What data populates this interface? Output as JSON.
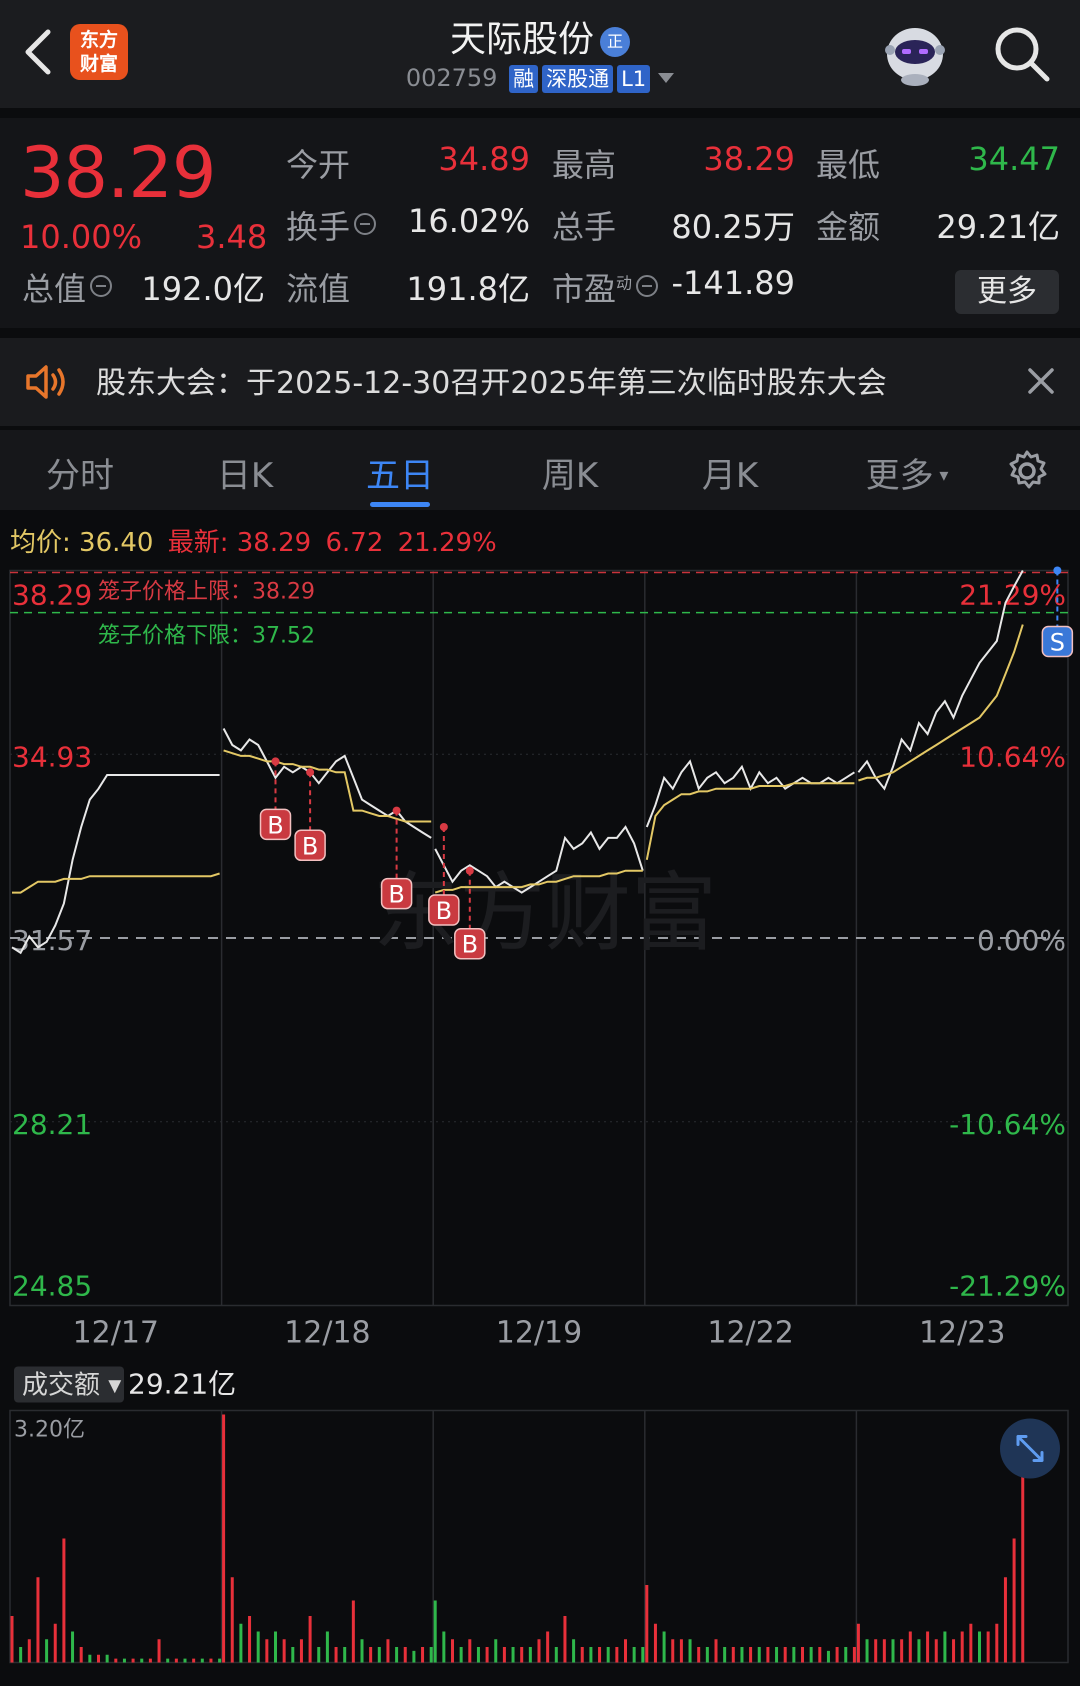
{
  "header": {
    "title": "天际股份",
    "title_badge": "正",
    "code": "002759",
    "tags": [
      "融",
      "深股通",
      "L1"
    ],
    "logo_text": [
      "东方",
      "财富"
    ]
  },
  "quote": {
    "price": "38.29",
    "change_pct": "10.00%",
    "change": "3.48",
    "rows": [
      [
        {
          "label": "今开",
          "value": "34.89",
          "color": "#e8303a"
        },
        {
          "label": "最高",
          "value": "38.29",
          "color": "#e8303a"
        },
        {
          "label": "最低",
          "value": "34.47",
          "color": "#2fb84b"
        }
      ],
      [
        {
          "label": "换手",
          "value": "16.02%",
          "color": "#e6e6e6"
        },
        {
          "label": "总手",
          "value": "80.25万",
          "color": "#e6e6e6"
        },
        {
          "label": "金额",
          "value": "29.21亿",
          "color": "#e6e6e6"
        }
      ],
      [
        {
          "label": "总值",
          "value": "192.0亿",
          "color": "#e6e6e6"
        },
        {
          "label": "流值",
          "value": "191.8亿",
          "color": "#e6e6e6"
        },
        {
          "label": "市盈",
          "value": "-141.89",
          "color": "#e6e6e6"
        }
      ]
    ],
    "pe_sup": "动",
    "more_label": "更多"
  },
  "notice": {
    "text": "股东大会：于2025-12-30召开2025年第三次临时股东大会"
  },
  "tabs": [
    "分时",
    "日K",
    "五日",
    "周K",
    "月K",
    "更多"
  ],
  "active_tab": "五日",
  "avg_bar": {
    "avg_label": "均价:",
    "avg_value": "36.40",
    "latest_label": "最新:",
    "latest_value": "38.29",
    "latest_change": "6.72",
    "latest_pct": "21.29%"
  },
  "chart_data": {
    "type": "line",
    "title": "",
    "x_labels": [
      "12/17",
      "12/18",
      "12/19",
      "12/22",
      "12/23"
    ],
    "y_ticks_left": [
      "38.29",
      "34.93",
      "31.57",
      "28.21",
      "24.85"
    ],
    "y_ticks_right": [
      "21.29%",
      "10.64%",
      "0.00%",
      "-10.64%",
      "-21.29%"
    ],
    "ylim": [
      24.85,
      38.29
    ],
    "base_price": 31.57,
    "cage_upper_label": "笼子价格上限：38.29",
    "cage_lower_label": "笼子价格下限：37.52",
    "cage_upper": 38.29,
    "cage_lower": 37.52,
    "watermark": "东方财富",
    "series": [
      {
        "values": [
          31.4,
          31.3,
          31.6,
          31.4,
          31.5,
          31.8,
          32.2,
          33.0,
          33.6,
          34.1,
          34.3,
          34.55,
          34.55,
          34.55,
          34.55,
          34.55,
          34.55,
          34.55,
          34.55,
          34.55,
          34.55,
          34.55,
          34.55,
          34.55,
          34.55,
          35.4,
          35.1,
          35.0,
          35.2,
          35.1,
          34.8,
          34.5,
          34.7,
          34.6,
          34.7,
          34.6,
          34.4,
          34.6,
          34.8,
          34.9,
          34.5,
          34.1,
          34.0,
          33.9,
          33.8,
          33.9,
          33.7,
          33.6,
          33.5,
          33.4,
          33.2,
          32.9,
          32.6,
          32.8,
          32.9,
          32.8,
          32.7,
          32.5,
          32.6,
          32.5,
          32.4,
          32.5,
          32.6,
          32.7,
          32.8,
          33.4,
          33.2,
          33.3,
          33.5,
          33.2,
          33.4,
          33.4,
          33.6,
          33.3,
          32.8,
          33.6,
          34.0,
          34.5,
          34.3,
          34.6,
          34.8,
          34.3,
          34.5,
          34.6,
          34.4,
          34.5,
          34.7,
          34.3,
          34.6,
          34.4,
          34.5,
          34.3,
          34.4,
          34.5,
          34.4,
          34.4,
          34.5,
          34.4,
          34.5,
          34.6,
          34.6,
          34.8,
          34.5,
          34.3,
          34.7,
          35.2,
          35.0,
          35.5,
          35.3,
          35.7,
          35.9,
          35.6,
          36.0,
          36.3,
          36.6,
          36.8,
          37.0,
          37.7,
          38.0,
          38.29
        ],
        "role": "price"
      },
      {
        "values": [
          32.4,
          32.4,
          32.5,
          32.6,
          32.6,
          32.6,
          32.65,
          32.65,
          32.65,
          32.7,
          32.7,
          32.7,
          32.7,
          32.7,
          32.7,
          32.7,
          32.7,
          32.7,
          32.7,
          32.7,
          32.7,
          32.7,
          32.7,
          32.7,
          32.75,
          35.0,
          34.95,
          34.9,
          34.9,
          34.85,
          34.8,
          34.8,
          34.75,
          34.75,
          34.7,
          34.7,
          34.65,
          34.65,
          34.6,
          34.6,
          33.9,
          33.9,
          33.85,
          33.8,
          33.8,
          33.75,
          33.7,
          33.7,
          33.7,
          33.7,
          32.4,
          32.45,
          32.45,
          32.5,
          32.5,
          32.5,
          32.5,
          32.5,
          32.5,
          32.5,
          32.5,
          32.55,
          32.55,
          32.6,
          32.6,
          32.65,
          32.7,
          32.7,
          32.7,
          32.7,
          32.75,
          32.75,
          32.8,
          32.8,
          32.8,
          33.0,
          33.8,
          34.0,
          34.1,
          34.2,
          34.2,
          34.25,
          34.25,
          34.3,
          34.3,
          34.3,
          34.3,
          34.3,
          34.35,
          34.35,
          34.35,
          34.35,
          34.4,
          34.4,
          34.4,
          34.4,
          34.4,
          34.4,
          34.4,
          34.4,
          34.45,
          34.5,
          34.5,
          34.55,
          34.6,
          34.7,
          34.8,
          34.9,
          35.0,
          35.1,
          35.2,
          35.3,
          35.4,
          35.5,
          35.6,
          35.8,
          36.0,
          36.4,
          36.8,
          37.3
        ],
        "role": "average"
      }
    ],
    "trade_markers": [
      {
        "label": "B",
        "day": 1,
        "idx": 6,
        "price": 34.8
      },
      {
        "label": "B",
        "day": 1,
        "idx": 10,
        "price": 34.6
      },
      {
        "label": "B",
        "day": 1,
        "idx": 20,
        "price": 33.9
      },
      {
        "label": "B",
        "day": 1,
        "idx": 26,
        "price": 33.6
      },
      {
        "label": "B",
        "day": 2,
        "idx": 4,
        "price": 32.8
      },
      {
        "label": "S",
        "day": 4,
        "idx": 23,
        "price": 38.29
      }
    ]
  },
  "volume": {
    "selector_label": "成交额",
    "total": "29.21亿",
    "max_label": "3.20亿",
    "max_value": 3.2,
    "bars": [
      0.6,
      0.2,
      0.3,
      1.1,
      0.3,
      0.5,
      1.6,
      0.4,
      0.2,
      0.1,
      0.1,
      0.1,
      0.05,
      0.05,
      0.05,
      0.05,
      0.05,
      0.3,
      0.05,
      0.05,
      0.05,
      0.05,
      0.05,
      0.05,
      0.05,
      3.2,
      1.1,
      0.5,
      0.6,
      0.4,
      0.3,
      0.4,
      0.3,
      0.2,
      0.3,
      0.6,
      0.2,
      0.4,
      0.2,
      0.2,
      0.8,
      0.3,
      0.2,
      0.2,
      0.3,
      0.2,
      0.2,
      0.15,
      0.2,
      0.2,
      0.8,
      0.4,
      0.3,
      0.2,
      0.3,
      0.2,
      0.2,
      0.3,
      0.2,
      0.2,
      0.2,
      0.2,
      0.3,
      0.4,
      0.2,
      0.6,
      0.3,
      0.2,
      0.2,
      0.2,
      0.2,
      0.2,
      0.3,
      0.2,
      0.2,
      1.0,
      0.5,
      0.4,
      0.3,
      0.3,
      0.3,
      0.2,
      0.2,
      0.3,
      0.2,
      0.2,
      0.2,
      0.2,
      0.2,
      0.2,
      0.2,
      0.2,
      0.2,
      0.2,
      0.2,
      0.2,
      0.15,
      0.2,
      0.2,
      0.2,
      0.5,
      0.3,
      0.3,
      0.3,
      0.3,
      0.3,
      0.4,
      0.3,
      0.4,
      0.3,
      0.4,
      0.3,
      0.4,
      0.5,
      0.4,
      0.4,
      0.5,
      1.1,
      1.6,
      2.5
    ],
    "bar_up": [
      1,
      0,
      1,
      1,
      0,
      1,
      1,
      0,
      1,
      0,
      1,
      0,
      1,
      0,
      1,
      0,
      1,
      1,
      0,
      1,
      0,
      1,
      0,
      1,
      0,
      1,
      1,
      0,
      1,
      0,
      1,
      0,
      1,
      0,
      1,
      1,
      0,
      0,
      1,
      0,
      1,
      0,
      1,
      0,
      1,
      0,
      1,
      0,
      1,
      0,
      0,
      0,
      1,
      0,
      1,
      0,
      1,
      0,
      1,
      0,
      1,
      0,
      1,
      1,
      0,
      1,
      0,
      1,
      0,
      1,
      0,
      1,
      1,
      0,
      0,
      1,
      1,
      0,
      1,
      1,
      0,
      1,
      0,
      1,
      0,
      1,
      0,
      1,
      0,
      1,
      0,
      1,
      0,
      1,
      0,
      1,
      0,
      1,
      0,
      1,
      1,
      0,
      1,
      1,
      0,
      1,
      1,
      0,
      1,
      1,
      0,
      1,
      1,
      1,
      0,
      1,
      1,
      1,
      1,
      1
    ]
  }
}
